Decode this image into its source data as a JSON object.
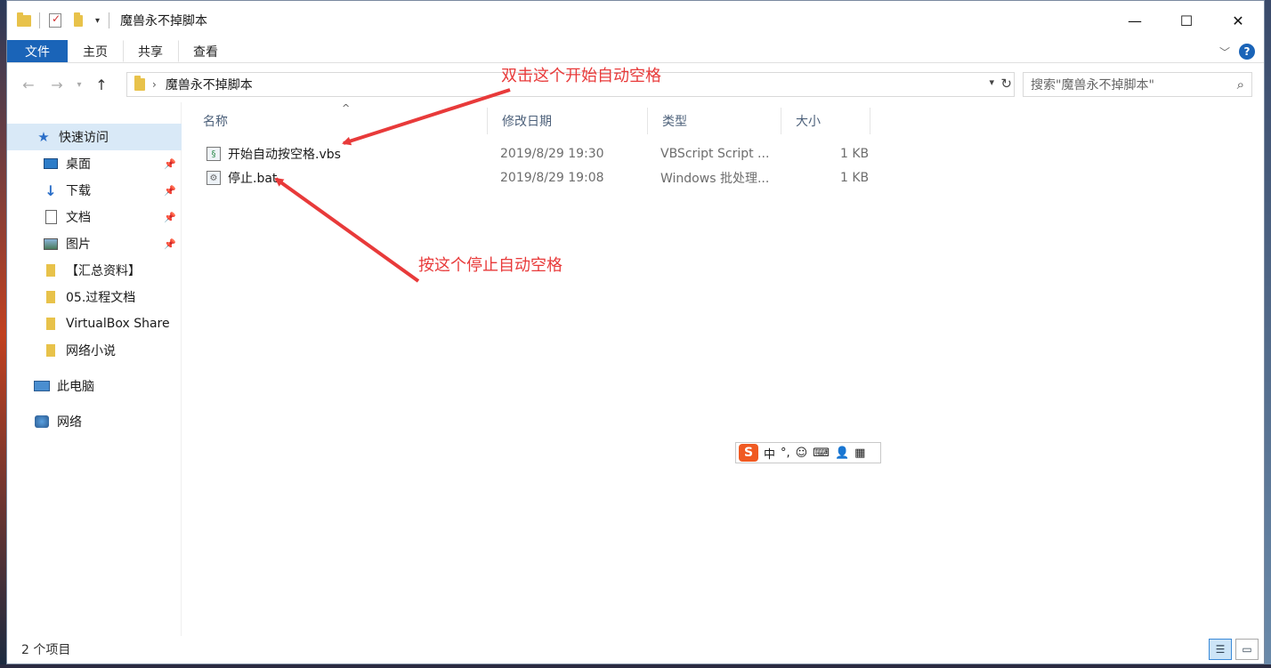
{
  "window": {
    "title": "魔兽永不掉脚本"
  },
  "ribbon": {
    "tabs": [
      "文件",
      "主页",
      "共享",
      "查看"
    ],
    "help": "?"
  },
  "address": {
    "path": "魔兽永不掉脚本"
  },
  "search": {
    "placeholder": "搜索\"魔兽永不掉脚本\""
  },
  "sidebar": {
    "items": [
      {
        "label": "快速访问",
        "icon": "star-icon"
      },
      {
        "label": "桌面",
        "icon": "desktop-icon",
        "pinned": true
      },
      {
        "label": "下载",
        "icon": "download-icon",
        "pinned": true
      },
      {
        "label": "文档",
        "icon": "document-icon",
        "pinned": true
      },
      {
        "label": "图片",
        "icon": "picture-icon",
        "pinned": true
      },
      {
        "label": "【汇总资料】",
        "icon": "folder-icon"
      },
      {
        "label": "05.过程文档",
        "icon": "folder-icon"
      },
      {
        "label": "VirtualBox Share",
        "icon": "folder-icon"
      },
      {
        "label": "网络小说",
        "icon": "folder-icon"
      },
      {
        "label": "此电脑",
        "icon": "computer-icon"
      },
      {
        "label": "网络",
        "icon": "network-icon"
      }
    ]
  },
  "columns": [
    "名称",
    "修改日期",
    "类型",
    "大小"
  ],
  "files": [
    {
      "name": "开始自动按空格.vbs",
      "date": "2019/8/29 19:30",
      "type": "VBScript Script ...",
      "size": "1 KB"
    },
    {
      "name": "停止.bat",
      "date": "2019/8/29 19:08",
      "type": "Windows 批处理...",
      "size": "1 KB"
    }
  ],
  "annotations": {
    "top": "双击这个开始自动空格",
    "bottom": "按这个停止自动空格",
    "color": "#e83a3a"
  },
  "ime": {
    "s": "S",
    "mode": "中",
    "punct": "°,"
  },
  "status": {
    "count": "2 个项目"
  }
}
